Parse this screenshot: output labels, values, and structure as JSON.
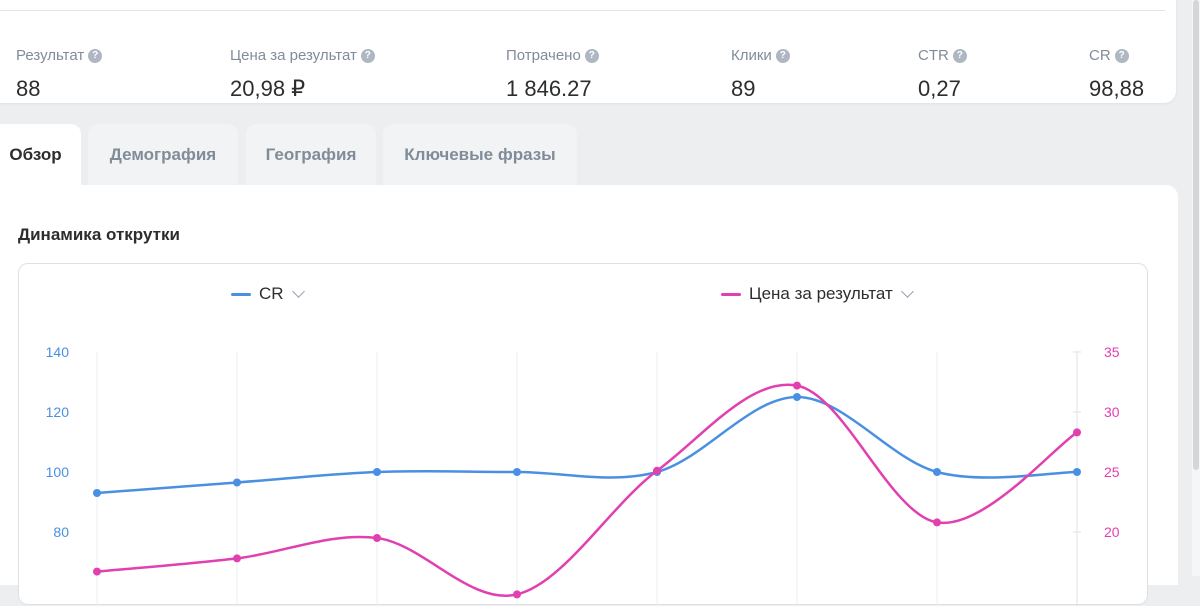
{
  "metrics": [
    {
      "label": "Результат",
      "value": "88"
    },
    {
      "label": "Цена за результат",
      "value": "20,98 ₽"
    },
    {
      "label": "Потрачено",
      "value": "1 846.27"
    },
    {
      "label": "Клики",
      "value": "89"
    },
    {
      "label": "CTR",
      "value": "0,27"
    },
    {
      "label": "CR",
      "value": "98,88"
    }
  ],
  "tabs": [
    {
      "label": "Обзор",
      "active": true
    },
    {
      "label": "Демография",
      "active": false
    },
    {
      "label": "География",
      "active": false
    },
    {
      "label": "Ключевые фразы",
      "active": false
    }
  ],
  "panel": {
    "title": "Динамика открутки"
  },
  "colors": {
    "cr": "#4a90e2",
    "price": "#e040b0"
  },
  "chart_data": {
    "type": "line",
    "x": [
      0,
      1,
      2,
      3,
      4,
      5,
      6,
      7
    ],
    "series": [
      {
        "name": "CR",
        "axis": "left",
        "values": [
          93,
          96.5,
          100,
          100,
          100,
          125,
          100,
          100
        ]
      },
      {
        "name": "Цена за результат",
        "axis": "right",
        "values": [
          16.7,
          17.8,
          19.5,
          14.8,
          25.1,
          32.2,
          20.8,
          28.3
        ]
      }
    ],
    "y_left": {
      "ticks": [
        80,
        100,
        120,
        140
      ],
      "range": [
        60,
        140
      ]
    },
    "y_right": {
      "ticks": [
        20,
        25,
        30,
        35
      ],
      "range": [
        15,
        35
      ]
    },
    "grid": "vertical"
  }
}
